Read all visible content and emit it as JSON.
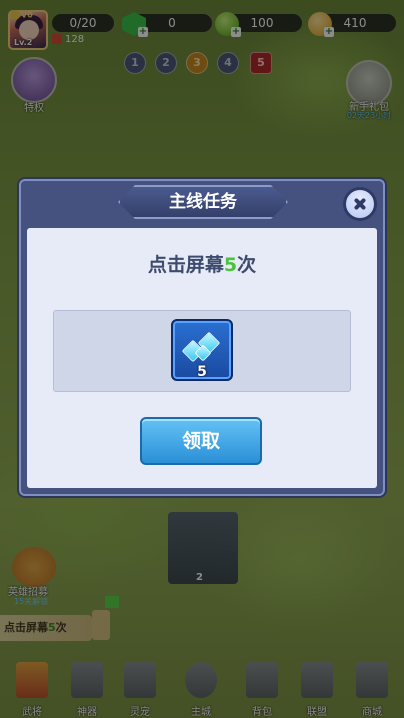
{
  "player": {
    "vip": "V0",
    "level": "Lv.2",
    "power": "128"
  },
  "resources": {
    "stamina": "0/20",
    "gems": "0",
    "green_orbs": "100",
    "gold": "410"
  },
  "stages": [
    "1",
    "2",
    "3",
    "4",
    "5"
  ],
  "side": {
    "privilege": "特权",
    "newbie_gift": "新手礼包",
    "newbie_timer": "02天23小时"
  },
  "modal": {
    "title": "主线任务",
    "task_prefix": "点击屏幕",
    "task_count": "5",
    "task_suffix": "次",
    "reward_count": "5",
    "claim_label": "领取"
  },
  "map": {
    "castle_level": "2",
    "recruit_label": "英雄招募",
    "recruit_sub": "15关解锁",
    "banner_prefix": "点击屏幕",
    "banner_count": "5",
    "banner_suffix": "次"
  },
  "nav": [
    {
      "label": "武将"
    },
    {
      "label": "神器"
    },
    {
      "label": "灵宠"
    },
    {
      "label": "主城"
    },
    {
      "label": "背包"
    },
    {
      "label": "联盟"
    },
    {
      "label": "商城"
    }
  ]
}
